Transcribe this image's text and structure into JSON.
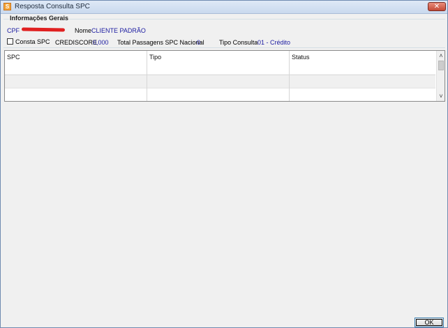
{
  "window": {
    "title": "Resposta Consulta SPC",
    "close_glyph": "✕",
    "app_icon_glyph": "S"
  },
  "group": {
    "title": "Informações Gerais",
    "cpf_label": "CPF",
    "name_label": "Nome",
    "name_value": "CLIENTE PADRÃO",
    "consta_spc_label": "Consta SPC",
    "consta_spc_checked": false,
    "crediscore_label": "CREDISCORE",
    "crediscore_value": "0,000",
    "total_passagens_label": "Total Passagens SPC Nacional",
    "total_passagens_value": "0",
    "tipo_consulta_label": "Tipo Consulta",
    "tipo_consulta_value": "01 - Crédito"
  },
  "grid": {
    "columns": [
      "SPC",
      "Tipo",
      "Status"
    ],
    "scroll_up_glyph": "˄",
    "scroll_down_glyph": "˅"
  },
  "footer": {
    "ok_label": "OK"
  },
  "colors": {
    "value_text": "#1a1aa0",
    "redaction": "#e02020",
    "close_button": "#c44a36",
    "app_icon": "#f3a53a"
  }
}
